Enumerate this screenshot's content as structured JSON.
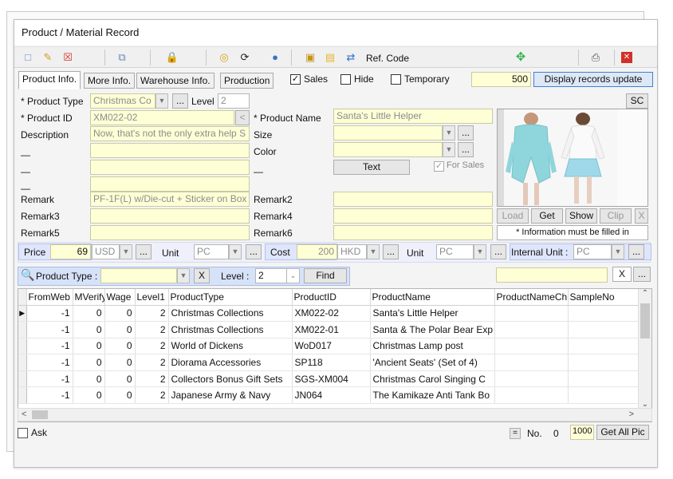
{
  "window": {
    "title": "Product / Material Record"
  },
  "toolbar": {
    "ref_code": "Ref. Code"
  },
  "tabs": [
    "Product Info.",
    "More Info.",
    "Warehouse Info.",
    "Production"
  ],
  "options": {
    "sales": "Sales",
    "hide": "Hide",
    "temporary": "Temporary",
    "record_count": "500",
    "display_btn": "Display records update",
    "sc": "SC"
  },
  "form": {
    "product_type_label": "* Product Type",
    "product_type_value": "Christmas Co",
    "level_label": "Level",
    "level_value": "2",
    "product_id_label": "* Product ID",
    "product_id_value": "XM022-02",
    "product_name_label": "* Product Name",
    "product_name_value": "Santa's Little Helper",
    "description_label": "Description",
    "description_value": "Now, that's not the only extra help S",
    "size_label": "Size",
    "color_label": "Color",
    "dash": "—",
    "text_btn": "Text",
    "for_sales": "For Sales",
    "remark_label": "Remark",
    "remark_value": "PF-1F(L) w/Die-cut + Sticker on Box",
    "remark2_label": "Remark2",
    "remark3_label": "Remark3",
    "remark4_label": "Remark4",
    "remark5_label": "Remark5",
    "remark6_label": "Remark6"
  },
  "picture": {
    "load": "Load",
    "get": "Get",
    "show": "Show",
    "clip": "Clip",
    "x": "X",
    "info": "* Information must be filled in"
  },
  "pricing": {
    "price_label": "Price",
    "price_value": "69",
    "currency1": "USD",
    "unit_label": "Unit",
    "unit1": "PC",
    "cost_label": "Cost",
    "cost_value": "200",
    "currency2": "HKD",
    "unit2": "PC",
    "internal_unit_label": "Internal Unit :",
    "internal_unit": "PC",
    "ellipsis": "..."
  },
  "filter": {
    "product_type_label": "Product Type :",
    "x": "X",
    "level_label": "Level :",
    "level_value": "2",
    "find": "Find",
    "clear": "X",
    "more": "..."
  },
  "grid": {
    "columns": [
      "FromWeb",
      "MVerify",
      "Wage",
      "Level1",
      "ProductType",
      "ProductID",
      "ProductName",
      "ProductNameCh",
      "SampleNo"
    ],
    "rows": [
      [
        "-1",
        "0",
        "0",
        "2",
        "Christmas Collections",
        "XM022-02",
        "Santa's Little Helper",
        "",
        ""
      ],
      [
        "-1",
        "0",
        "0",
        "2",
        "Christmas Collections",
        "XM022-01",
        "Santa & The Polar Bear Exp",
        "",
        ""
      ],
      [
        "-1",
        "0",
        "0",
        "2",
        "World of Dickens",
        "WoD017",
        "Christmas Lamp post",
        "",
        ""
      ],
      [
        "-1",
        "0",
        "0",
        "2",
        "Diorama Accessories",
        "SP118",
        "'Ancient Seats' (Set of 4)",
        "",
        ""
      ],
      [
        "-1",
        "0",
        "0",
        "2",
        "Collectors Bonus Gift Sets",
        "SGS-XM004",
        "Christmas Carol Singing C",
        "",
        ""
      ],
      [
        "-1",
        "0",
        "0",
        "2",
        "Japanese Army & Navy",
        "JN064",
        "The Kamikaze Anti Tank Bo",
        "",
        ""
      ]
    ]
  },
  "footer": {
    "ask": "Ask",
    "eq": "=",
    "no_label": "No.",
    "no_value": "0",
    "count": "1000",
    "get_all": "Get All Pic"
  }
}
